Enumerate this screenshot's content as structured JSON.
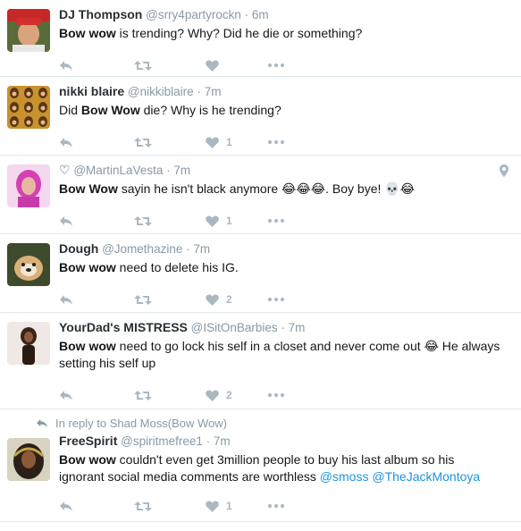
{
  "tweets": [
    {
      "name": "DJ Thompson",
      "handle": "@srry4partyrockn",
      "time": "6m",
      "text_parts": [
        {
          "t": "Bow wow",
          "b": true
        },
        {
          "t": " is trending? Why? Did he die or something?"
        }
      ],
      "likes": ""
    },
    {
      "name": "nikki blaire",
      "handle": "@nikkiblaire",
      "time": "7m",
      "text_parts": [
        {
          "t": "Did "
        },
        {
          "t": "Bow Wow",
          "b": true
        },
        {
          "t": " die? Why is he trending?"
        }
      ],
      "likes": "1"
    },
    {
      "name": "♡",
      "handle": "@MartinLaVesta",
      "time": "7m",
      "text_parts": [
        {
          "t": "Bow Wow",
          "b": true
        },
        {
          "t": " sayin he isn't black anymore 😂😂😂. Boy bye! 💀😂"
        }
      ],
      "likes": "1",
      "has_location": true
    },
    {
      "name": "Dough",
      "handle": "@Jomethazine",
      "time": "7m",
      "text_parts": [
        {
          "t": "Bow wow",
          "b": true
        },
        {
          "t": " need to delete his IG."
        }
      ],
      "likes": "2"
    },
    {
      "name": "YourDad's MISTRESS",
      "handle": "@ISitOnBarbies",
      "time": "7m",
      "text_parts": [
        {
          "t": "Bow wow",
          "b": true
        },
        {
          "t": " need to go lock his self in a closet and never come out 😂 He always setting his self up"
        }
      ],
      "likes": "2"
    },
    {
      "context": "In reply to Shad Moss(Bow Wow)",
      "name": "FreeSpirit",
      "handle": "@spiritmefree1",
      "time": "7m",
      "text_parts": [
        {
          "t": "Bow wow",
          "b": true
        },
        {
          "t": " couldn't even get 3million people to buy his last album so his ignorant social media comments are worthless "
        },
        {
          "t": "@smoss",
          "m": true
        },
        {
          "t": " "
        },
        {
          "t": "@TheJackMontoya",
          "m": true
        }
      ],
      "likes": "1"
    }
  ],
  "icons": {
    "reply": "reply-icon",
    "retweet": "retweet-icon",
    "like": "heart-icon",
    "more": "more-icon",
    "location": "location-pin-icon"
  },
  "colors": {
    "action_gray": "#aab8c2",
    "meta_gray": "#8899a6",
    "link_blue": "#1b95e0",
    "divider": "#e1e8ed"
  }
}
